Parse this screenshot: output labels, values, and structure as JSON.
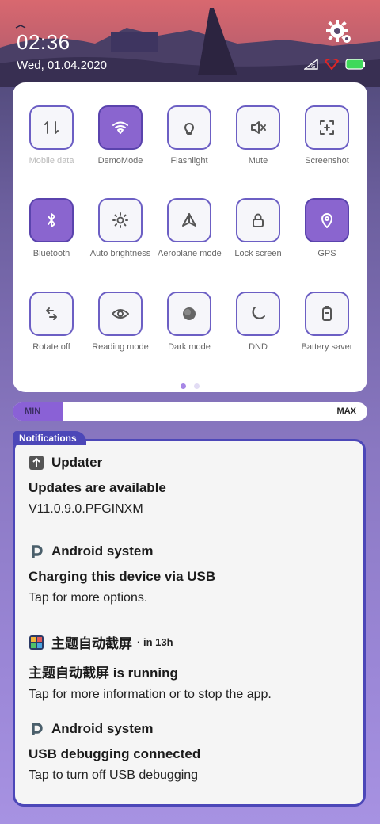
{
  "status": {
    "time": "02:36",
    "date": "Wed, 01.04.2020"
  },
  "quick_settings": {
    "tiles": [
      {
        "label": "Mobile data",
        "icon": "mobile-data-icon",
        "active": false,
        "disabled": true
      },
      {
        "label": "DemoMode",
        "icon": "wifi-icon",
        "active": true,
        "disabled": false
      },
      {
        "label": "Flashlight",
        "icon": "flashlight-icon",
        "active": false,
        "disabled": false
      },
      {
        "label": "Mute",
        "icon": "mute-icon",
        "active": false,
        "disabled": false
      },
      {
        "label": "Screenshot",
        "icon": "screenshot-icon",
        "active": false,
        "disabled": false
      },
      {
        "label": "Bluetooth",
        "icon": "bluetooth-icon",
        "active": true,
        "disabled": false
      },
      {
        "label": "Auto brightness",
        "icon": "brightness-icon",
        "active": false,
        "disabled": false
      },
      {
        "label": "Aeroplane mode",
        "icon": "airplane-icon",
        "active": false,
        "disabled": false
      },
      {
        "label": "Lock screen",
        "icon": "lock-icon",
        "active": false,
        "disabled": false
      },
      {
        "label": "GPS",
        "icon": "location-icon",
        "active": true,
        "disabled": false
      },
      {
        "label": "Rotate off",
        "icon": "rotate-icon",
        "active": false,
        "disabled": false
      },
      {
        "label": "Reading mode",
        "icon": "eye-icon",
        "active": false,
        "disabled": false
      },
      {
        "label": "Dark mode",
        "icon": "dark-mode-icon",
        "active": false,
        "disabled": false
      },
      {
        "label": "DND",
        "icon": "moon-icon",
        "active": false,
        "disabled": false
      },
      {
        "label": "Battery saver",
        "icon": "battery-saver-icon",
        "active": false,
        "disabled": false
      }
    ],
    "pages": 2,
    "current_page": 1
  },
  "brightness": {
    "min_label": "MIN",
    "max_label": "MAX",
    "level": 0.14
  },
  "notifications": {
    "header": "Notifications",
    "items": [
      {
        "app": "Updater",
        "icon": "update-arrow-icon",
        "time": "",
        "title": "Updates are available",
        "text": "V11.0.9.0.PFGINXM"
      },
      {
        "app": "Android system",
        "icon": "android-p-icon",
        "time": "",
        "title": "Charging this device via USB",
        "text": "Tap for more options."
      },
      {
        "app": "主题自动截屏",
        "icon": "theme-app-icon",
        "time": "in 13h",
        "title": "主题自动截屏 is running",
        "text": "Tap for more information or to stop the app."
      },
      {
        "app": "Android system",
        "icon": "android-p-icon",
        "time": "",
        "title": "USB debugging connected",
        "text": "Tap to turn off USB debugging"
      }
    ]
  },
  "colors": {
    "accent": "#8a65cf",
    "border": "#6c5fc4",
    "notif_border": "#4c47b8"
  }
}
